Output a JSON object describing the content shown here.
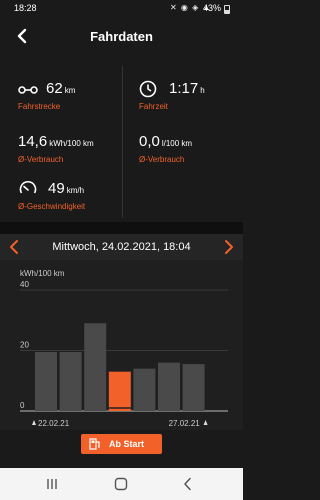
{
  "status": {
    "time": "18:28",
    "icons": "✕ ◉ ◈ ▲",
    "battery": "43%",
    "battery_level": 0.43
  },
  "header": {
    "title": "Fahrdaten"
  },
  "stats": [
    {
      "value": "62",
      "unit": "km",
      "label": "Fahrstrecke",
      "icon": "route-icon"
    },
    {
      "value": "1:17",
      "unit": "h",
      "label": "Fahrzeit",
      "icon": "clock-icon"
    },
    {
      "value": "14,6",
      "unit": "kWh/100 km",
      "label": "Ø-Verbrauch",
      "icon": "none"
    },
    {
      "value": "0,0",
      "unit": "l/100 km",
      "label": "Ø-Verbrauch",
      "icon": "none"
    },
    {
      "value": "49",
      "unit": "km/h",
      "label": "Ø-Geschwindigkeit",
      "icon": "speedometer-icon"
    }
  ],
  "date": {
    "label": "Mittwoch, 24.02.2021, 18:04"
  },
  "chart_data": {
    "type": "bar",
    "ylabel": "kWh/100 km",
    "ylim": [
      0,
      40
    ],
    "yticks": [
      0,
      20,
      40
    ],
    "values": [
      19.5,
      19.5,
      29,
      13,
      14,
      16,
      15.5
    ],
    "highlight_index": 3,
    "highlight_color": "#f2612a",
    "bar_color": "#4a4a4a",
    "x_labels": [
      "22.02.21",
      "27.02.21"
    ]
  },
  "start_button": {
    "label": "Ab Start"
  },
  "colors": {
    "accent": "#f2612a"
  }
}
